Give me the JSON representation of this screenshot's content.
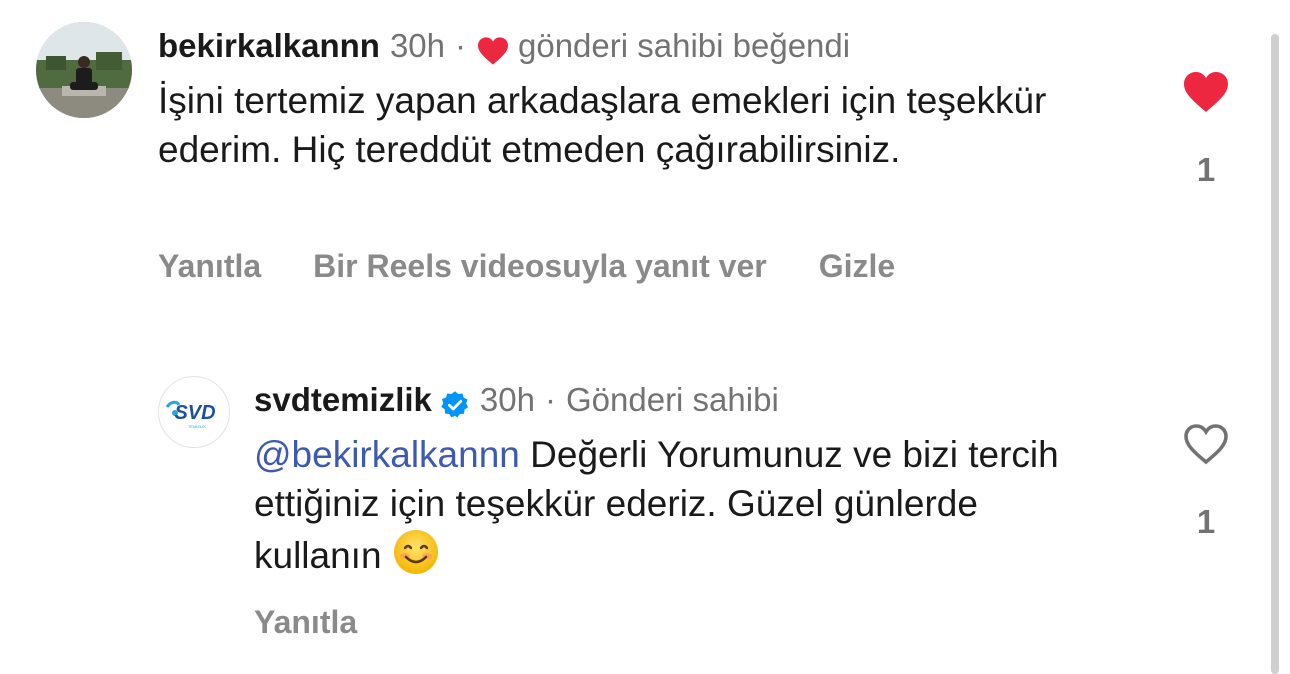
{
  "comments": [
    {
      "username": "bekirkalkannn",
      "time": "30h",
      "separator": "·",
      "liked_by_author_label": "gönderi sahibi beğendi",
      "text": "İşini tertemiz yapan arkadaşlara emekleri için teşekkür ederim. Hiç tereddüt etmeden çağırabilirsiniz.",
      "like_count": "1",
      "liked": true,
      "actions": {
        "reply": "Yanıtla",
        "reels_reply": "Bir Reels videosuyla yanıt ver",
        "hide": "Gizle"
      }
    },
    {
      "username": "svdtemizlik",
      "verified": true,
      "time": "30h",
      "separator": "·",
      "author_label": "Gönderi sahibi",
      "mention": "@bekirkalkannn",
      "text": " Değerli Yorumunuz ve bizi tercih ettiğiniz için teşekkür ederiz. Güzel günlerde kullanın",
      "emoji": "smiling-face-emoji",
      "like_count": "1",
      "liked": false,
      "actions": {
        "reply": "Yanıtla"
      },
      "avatar_logo_text": "SVD",
      "avatar_logo_subtext": "TEMİZLİK"
    }
  ],
  "colors": {
    "heart_red": "#ed2740",
    "mention_blue": "#3d5ab0",
    "verified_blue": "#0095f6",
    "muted": "#737373"
  }
}
